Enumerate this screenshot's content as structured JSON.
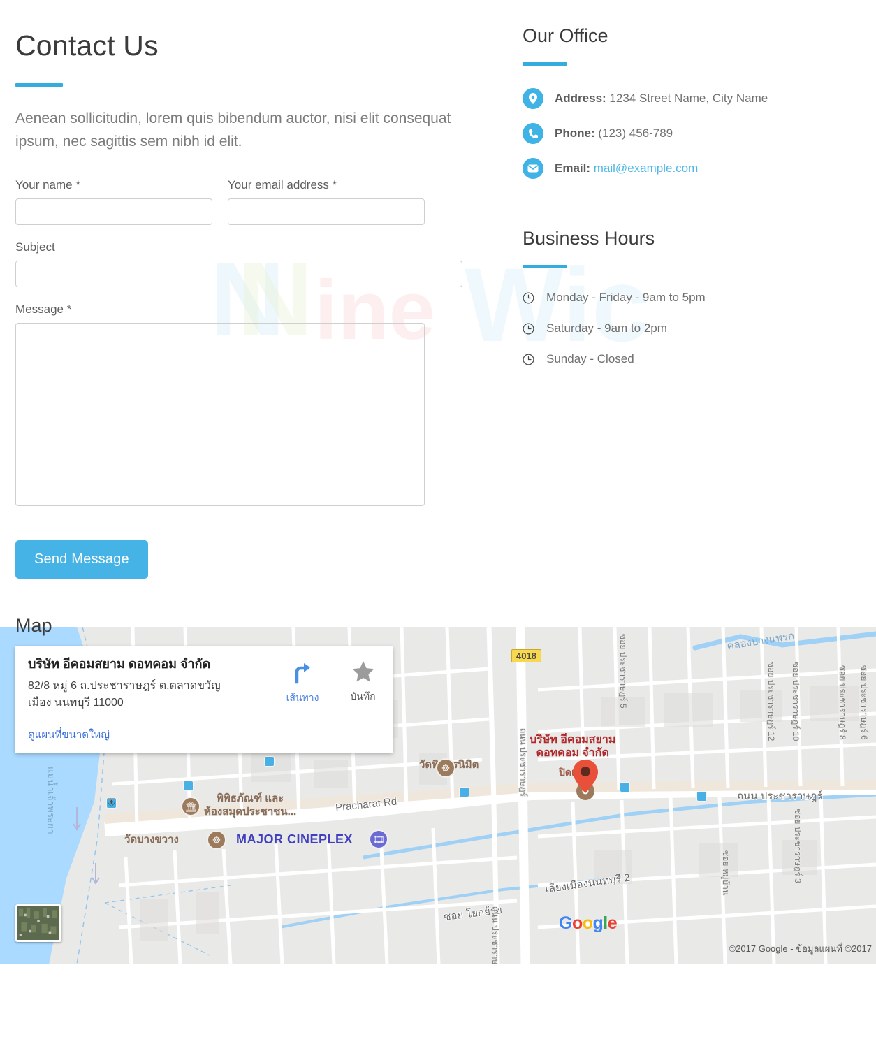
{
  "page": {
    "title": "Contact Us",
    "intro": "Aenean sollicitudin, lorem quis bibendum auctor, nisi elit consequat ipsum, nec sagittis sem nibh id elit.",
    "map_section_title": "Map",
    "accent_color": "#35ACDE",
    "watermark_text": "NineWic"
  },
  "form": {
    "fields": {
      "name": {
        "label": "Your name *",
        "value": "",
        "placeholder": ""
      },
      "email": {
        "label": "Your email address *",
        "value": "",
        "placeholder": ""
      },
      "subject": {
        "label": "Subject",
        "value": "",
        "placeholder": ""
      },
      "message": {
        "label": "Message *",
        "value": "",
        "placeholder": ""
      }
    },
    "submit_label": "Send Message"
  },
  "office": {
    "heading": "Our Office",
    "rows": [
      {
        "icon": "map-pin-icon",
        "label": "Address:",
        "value": "1234 Street Name, City Name",
        "is_link": false
      },
      {
        "icon": "phone-icon",
        "label": "Phone:",
        "value": "(123) 456-789",
        "is_link": false
      },
      {
        "icon": "envelope-icon",
        "label": "Email:",
        "value": "mail@example.com",
        "is_link": true
      }
    ]
  },
  "business_hours": {
    "heading": "Business Hours",
    "rows": [
      {
        "icon": "clock-icon",
        "text": "Monday - Friday - 9am to 5pm"
      },
      {
        "icon": "clock-icon",
        "text": "Saturday - 9am to 2pm"
      },
      {
        "icon": "clock-icon",
        "text": "Sunday - Closed"
      }
    ]
  },
  "map": {
    "card": {
      "title": "บริษัท อีคอมสยาม ดอทคอม จำกัด",
      "address_line1": "82/8 หมู่ 6 ถ.ประชาราษฎร์ ต.ตลาดขวัญ",
      "address_line2": "เมือง นนทบุรี 11000",
      "larger_map_link": "ดูแผนที่ขนาดใหญ่",
      "actions": [
        {
          "icon": "directions-icon",
          "label": "เส้นทาง"
        },
        {
          "icon": "star-icon",
          "label": "บันทึก"
        }
      ]
    },
    "marker": {
      "label_line1": "บริษัท อีคอมสยาม",
      "label_line2": "ดอทคอม จำกัด",
      "label_line3": "ปิดแล้ว"
    },
    "labels": [
      {
        "name": "watpoi-tinkoranimit",
        "text": "วัดทินกรนิมิต",
        "kind": "poi"
      },
      {
        "name": "poi-ruenjam-nonthaburi",
        "text": "เรือนจำจังหวัด\nนนทบุรี",
        "kind": "poi"
      },
      {
        "name": "poi-museum-library",
        "text": "พิพิธภัณฑ์ และ\nห้องสมุดประชาชน...",
        "kind": "poi"
      },
      {
        "name": "poi-wat-bangkhwang",
        "text": "วัดบางขวาง",
        "kind": "poi"
      },
      {
        "name": "poi-major-cineplex",
        "text": "MAJOR CINEPLEX",
        "kind": "brand"
      },
      {
        "name": "road-pracharat",
        "text": "Pracharat Rd",
        "kind": "road"
      },
      {
        "name": "road-thanon-pracharat",
        "text": "ถนน ประชาราษฎร์",
        "kind": "road"
      },
      {
        "name": "road-liang-mueang-nonthaburi-2",
        "text": "เลี่ยงเมืองนนทบุรี 2",
        "kind": "road"
      },
      {
        "name": "road-soi-yokyai",
        "text": "ซอย โยกย้าย",
        "kind": "road"
      },
      {
        "name": "canal-bangphrak",
        "text": "คลองบางแพรก",
        "kind": "water"
      },
      {
        "name": "river-chaophraya",
        "text": "แม่น้ำเจ้าพระยา",
        "kind": "water"
      },
      {
        "name": "soi-pracharat-12",
        "text": "ซอย ประชาราษฎร์ 12",
        "kind": "road-small"
      },
      {
        "name": "soi-pracharat-10",
        "text": "ซอย ประชาราษฎร์ 10",
        "kind": "road-small"
      },
      {
        "name": "soi-pracharat-8",
        "text": "ซอย ประชาราษฎร์ 8",
        "kind": "road-small"
      },
      {
        "name": "soi-pracharat-6",
        "text": "ซอย ประชาราษฎร์ 6",
        "kind": "road-small"
      },
      {
        "name": "soi-pracharat-3",
        "text": "ซอย ประชาราษฎร์ 3",
        "kind": "road-small"
      },
      {
        "name": "highway-shield",
        "text": "4018",
        "kind": "shield"
      }
    ],
    "attribution": "©2017 Google - ข้อมูลแผนที่ ©2017",
    "brand": "Google"
  }
}
